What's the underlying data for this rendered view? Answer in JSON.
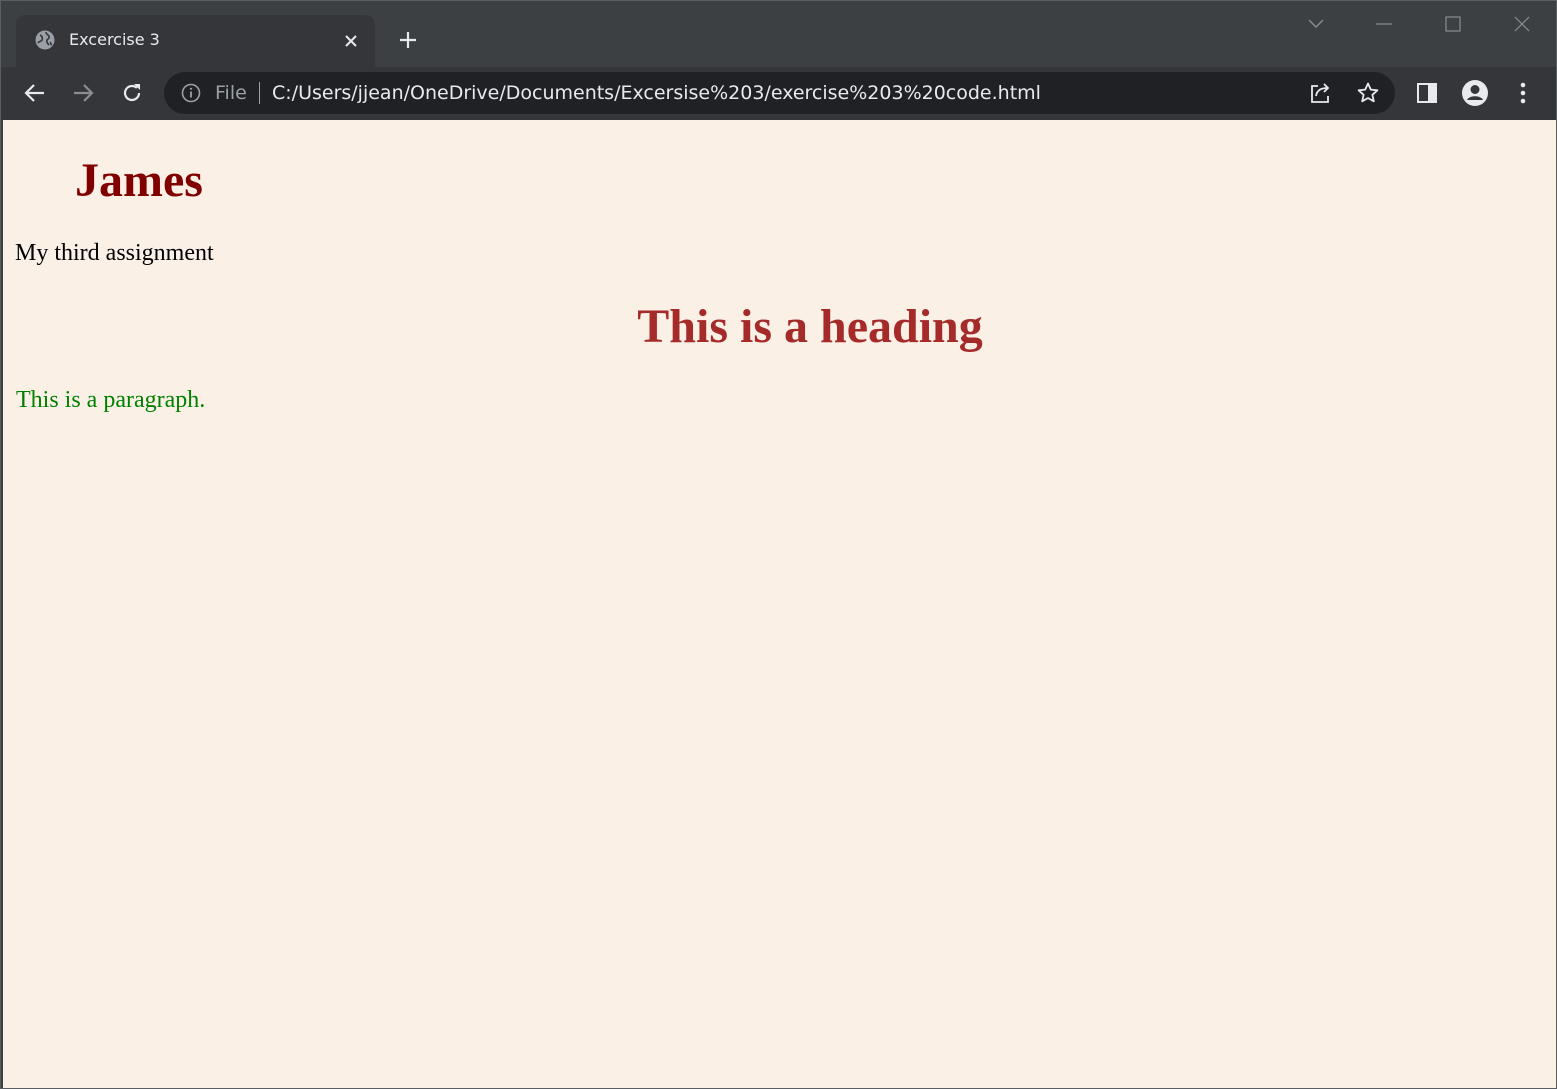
{
  "browser": {
    "tab": {
      "title": "Excercise 3",
      "favicon": "globe-icon",
      "close_icon": "close-icon"
    },
    "new_tab_icon": "plus-icon",
    "window_controls": [
      "chevron-down-icon",
      "minimize-icon",
      "maximize-icon",
      "close-icon"
    ],
    "toolbar": {
      "back_icon": "arrow-left-icon",
      "forward_icon": "arrow-right-icon",
      "reload_icon": "reload-icon",
      "scheme_label": "File",
      "info_icon": "info-icon",
      "url": "C:/Users/jjean/OneDrive/Documents/Excersise%203/exercise%203%20code.html",
      "share_icon": "share-icon",
      "bookmark_icon": "star-icon",
      "side_panel_icon": "side-panel-icon",
      "profile_icon": "profile-icon",
      "menu_icon": "kebab-menu-icon"
    },
    "colors": {
      "tabstrip": "#3c4043",
      "toolbar": "#35363a",
      "omnibox": "#202124"
    }
  },
  "page": {
    "background": "#fbf0e6",
    "name_heading": "James",
    "subtitle": "My third assignment",
    "heading": "This is a heading",
    "paragraph": "This is a paragraph.",
    "colors": {
      "name_heading": "#800000",
      "heading": "#a52a2a",
      "paragraph": "#008000"
    }
  }
}
